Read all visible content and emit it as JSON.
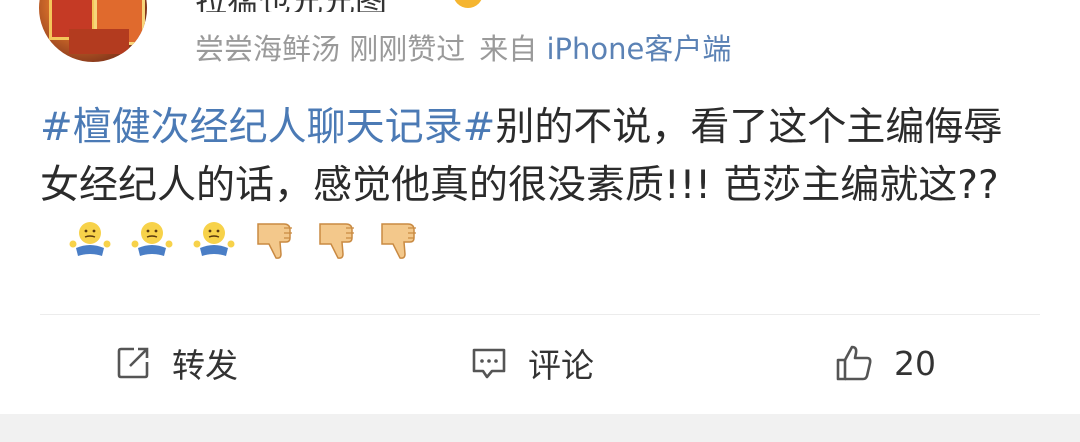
{
  "post": {
    "username": "拉猛也兄兄图",
    "meta": {
      "liked_by": "尝尝海鲜汤 刚刚赞过",
      "source_prefix": "来自",
      "source_client": "iPhone客户端"
    },
    "hashtag": "#檀健次经纪人聊天记录#",
    "body_text": "别的不说，看了这个主编侮辱女经纪人的话，感觉他真的很没素质!!! 芭莎主编就这??",
    "emojis": [
      "shrug-emoji",
      "shrug-emoji",
      "shrug-emoji",
      "thumbs-down-emoji",
      "thumbs-down-emoji",
      "thumbs-down-emoji"
    ]
  },
  "actions": {
    "repost_label": "转发",
    "comment_label": "评论",
    "like_count": "20"
  },
  "colors": {
    "link": "#4b7ab5",
    "meta": "#9a9a9a",
    "text": "#2b2b2b"
  }
}
